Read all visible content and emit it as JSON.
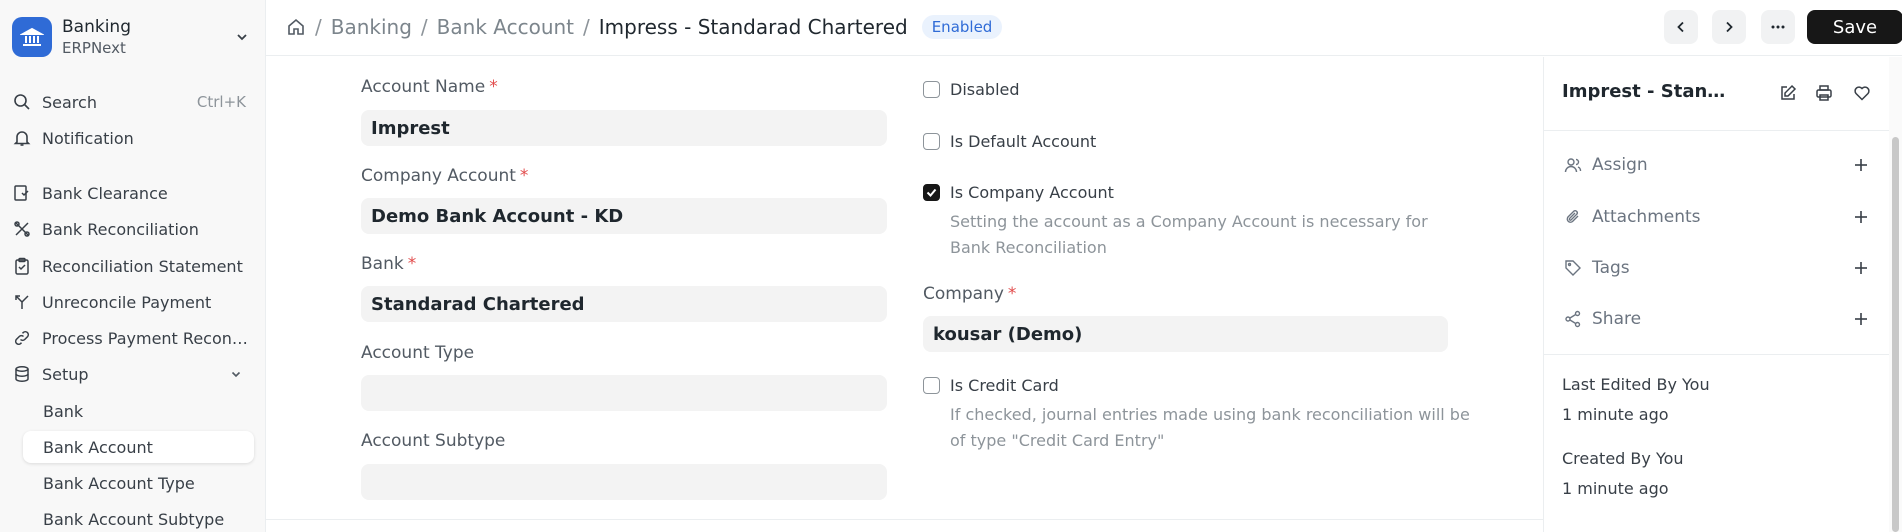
{
  "workspace": {
    "title": "Banking",
    "subtitle": "ERPNext"
  },
  "sidebar": {
    "search": {
      "label": "Search",
      "shortcut": "Ctrl+K"
    },
    "notification": {
      "label": "Notification"
    },
    "items": [
      {
        "label": "Bank Clearance",
        "icon": "book-check-icon"
      },
      {
        "label": "Bank Reconciliation",
        "icon": "tools-icon"
      },
      {
        "label": "Reconciliation Statement",
        "icon": "clipboard-check-icon"
      },
      {
        "label": "Unreconcile Payment",
        "icon": "split-icon"
      },
      {
        "label": "Process Payment Reconciliation",
        "icon": "link-icon"
      },
      {
        "label": "Setup",
        "icon": "database-icon"
      }
    ],
    "subitems": [
      {
        "label": "Bank"
      },
      {
        "label": "Bank Account"
      },
      {
        "label": "Bank Account Type"
      },
      {
        "label": "Bank Account Subtype"
      }
    ]
  },
  "breadcrumb": {
    "items": [
      "Banking",
      "Bank Account"
    ],
    "current": "Impress - Standarad Chartered",
    "status": "Enabled"
  },
  "toolbar": {
    "save_label": "Save"
  },
  "form": {
    "account_name": {
      "label": "Account Name",
      "value": "Imprest"
    },
    "company_account": {
      "label": "Company Account",
      "value": "Demo Bank Account - KD"
    },
    "bank": {
      "label": "Bank",
      "value": "Standarad Chartered"
    },
    "account_type": {
      "label": "Account Type",
      "value": ""
    },
    "account_subtype": {
      "label": "Account Subtype",
      "value": ""
    },
    "disabled": {
      "label": "Disabled",
      "checked": false
    },
    "is_default": {
      "label": "Is Default Account",
      "checked": false
    },
    "is_company": {
      "label": "Is Company Account",
      "checked": true,
      "desc1": "Setting the account as a Company Account is necessary for",
      "desc2": "Bank Reconciliation"
    },
    "company": {
      "label": "Company",
      "value": "kousar (Demo)"
    },
    "is_credit_card": {
      "label": "Is Credit Card",
      "checked": false,
      "desc1": "If checked, journal entries made using bank reconciliation will be",
      "desc2": "of type \"Credit Card Entry\""
    }
  },
  "sidepanel": {
    "title": "Imprest - Standarad Chartered",
    "actions": [
      {
        "label": "Assign",
        "icon": "user-icon"
      },
      {
        "label": "Attachments",
        "icon": "paperclip-icon"
      },
      {
        "label": "Tags",
        "icon": "tag-icon"
      },
      {
        "label": "Share",
        "icon": "share-icon"
      }
    ],
    "last_edited": "Last Edited By You",
    "last_edited_time": "1 minute ago",
    "created": "Created By You",
    "created_time": "1 minute ago"
  },
  "colors": {
    "accent": "#2f6bd6",
    "required": "#e24c4c",
    "primary_button": "#171717"
  }
}
